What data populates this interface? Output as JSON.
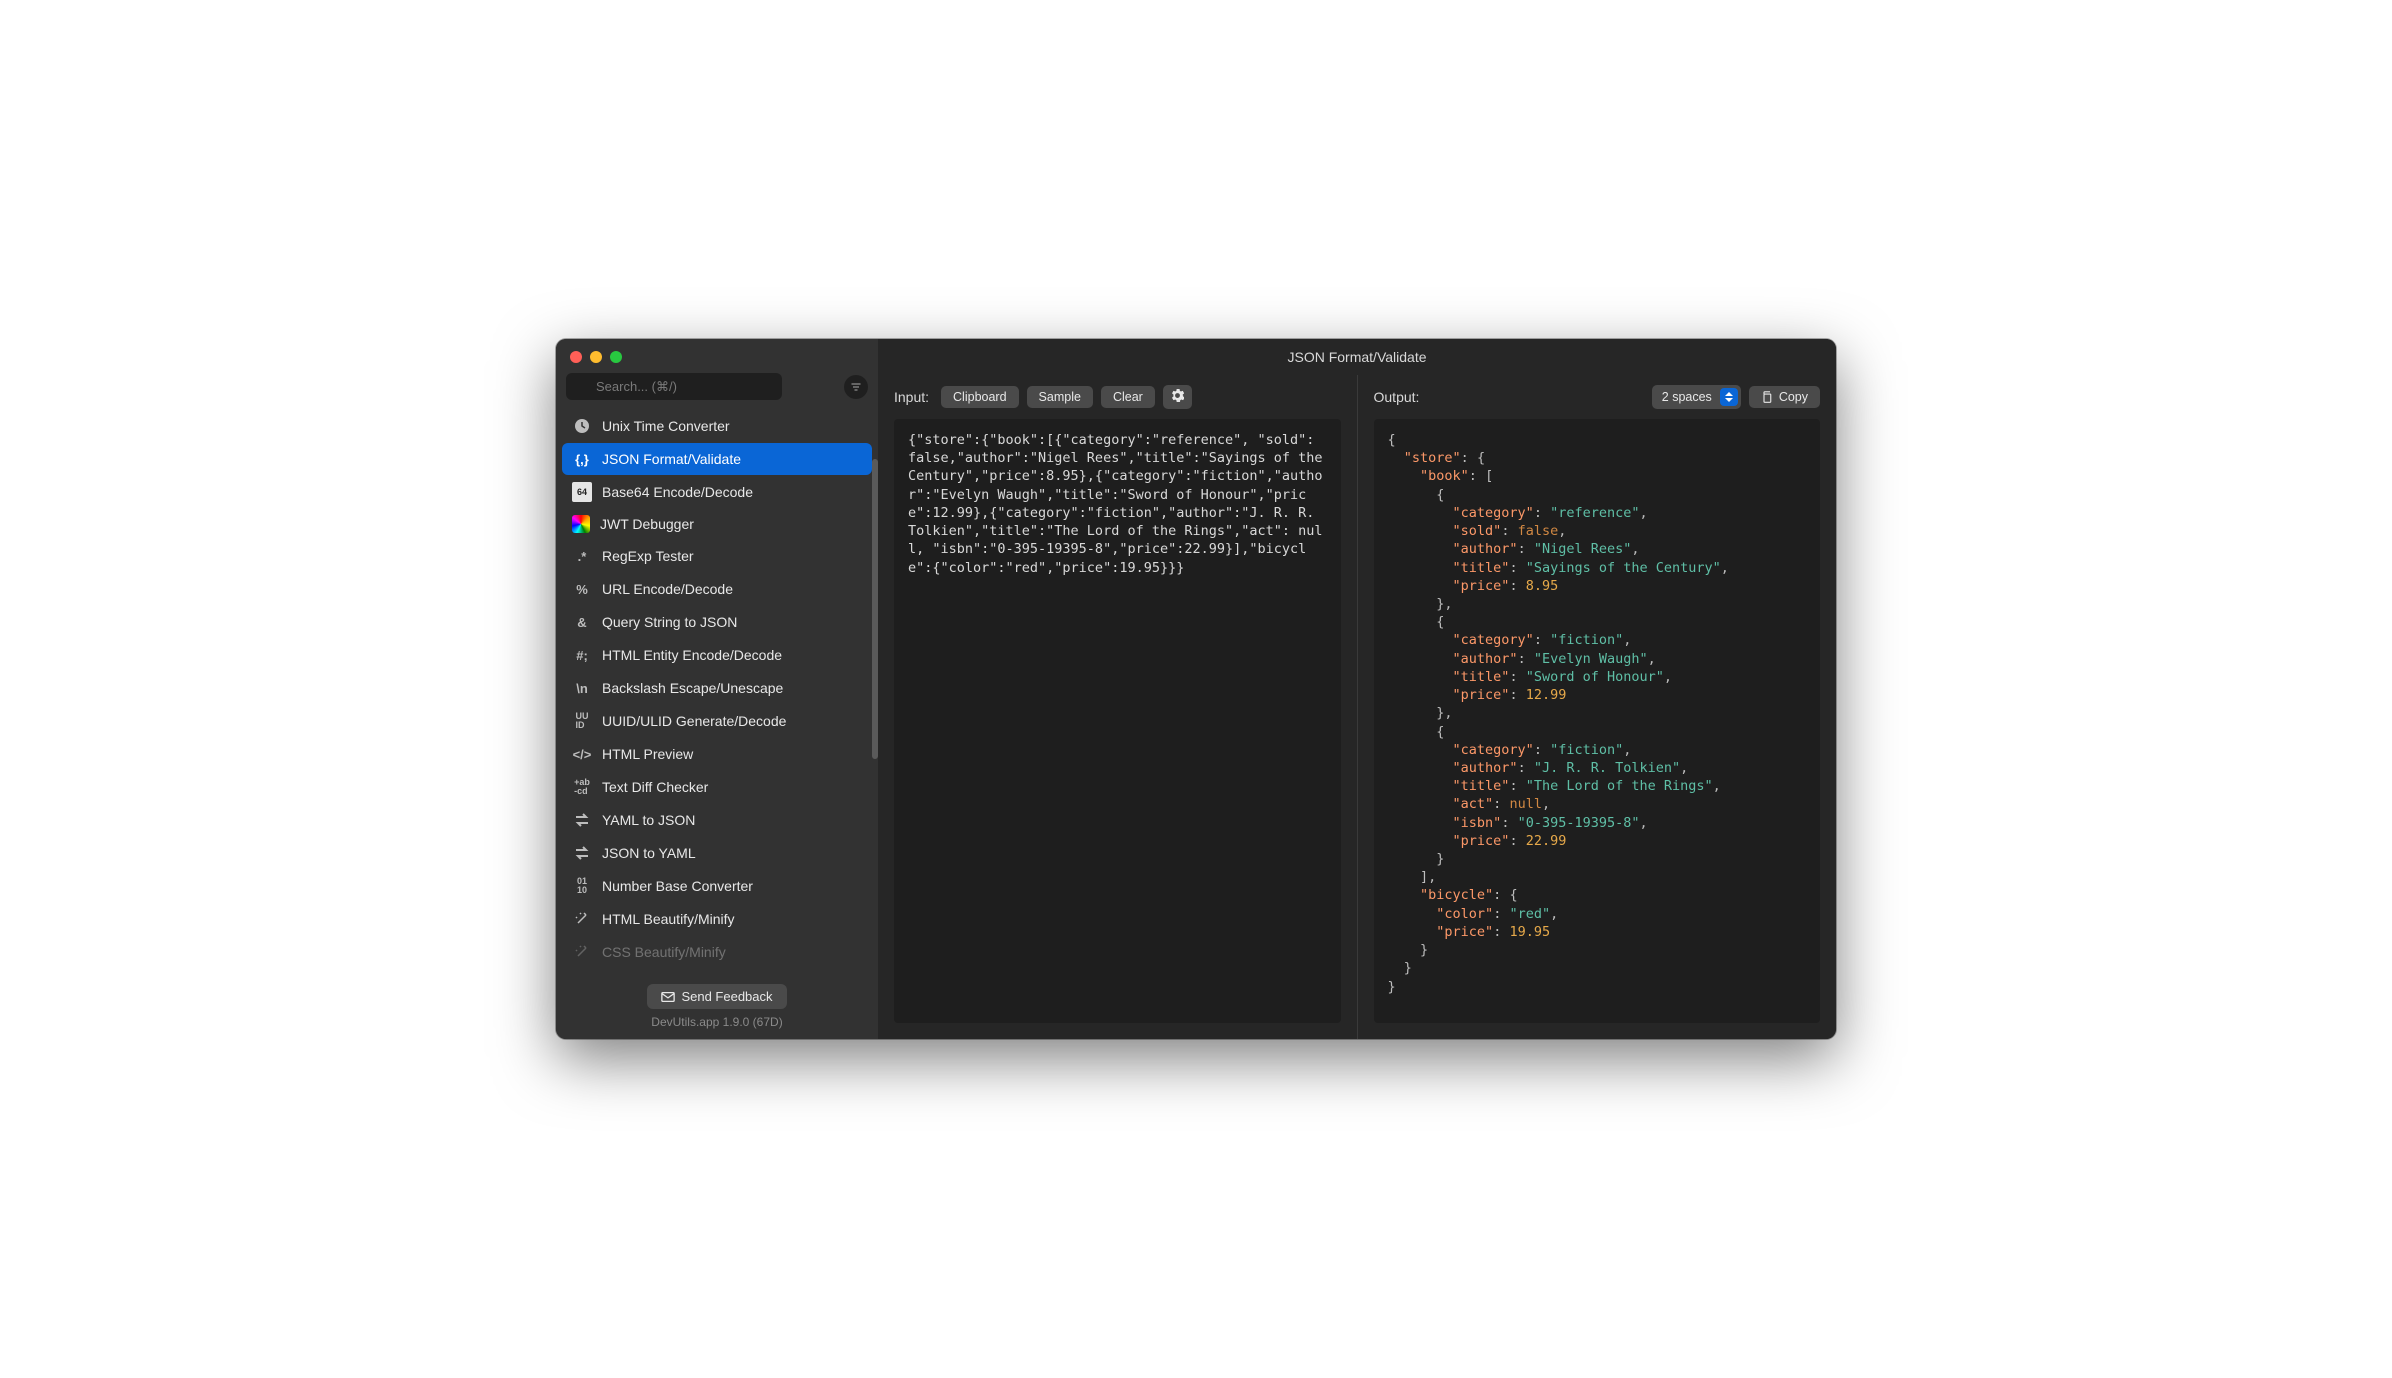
{
  "window": {
    "title": "JSON Format/Validate"
  },
  "search": {
    "placeholder": "Search... (⌘/)"
  },
  "sidebar": {
    "items": [
      {
        "label": "Unix Time Converter"
      },
      {
        "label": "JSON Format/Validate"
      },
      {
        "label": "Base64 Encode/Decode"
      },
      {
        "label": "JWT Debugger"
      },
      {
        "label": "RegExp Tester"
      },
      {
        "label": "URL Encode/Decode"
      },
      {
        "label": "Query String to JSON"
      },
      {
        "label": "HTML Entity Encode/Decode"
      },
      {
        "label": "Backslash Escape/Unescape"
      },
      {
        "label": "UUID/ULID Generate/Decode"
      },
      {
        "label": "HTML Preview"
      },
      {
        "label": "Text Diff Checker"
      },
      {
        "label": "YAML to JSON"
      },
      {
        "label": "JSON to YAML"
      },
      {
        "label": "Number Base Converter"
      },
      {
        "label": "HTML Beautify/Minify"
      },
      {
        "label": "CSS Beautify/Minify"
      }
    ]
  },
  "footer": {
    "feedback_label": "Send Feedback",
    "version_text": "DevUtils.app 1.9.0 (67D)"
  },
  "input": {
    "label": "Input:",
    "buttons": {
      "clipboard": "Clipboard",
      "sample": "Sample",
      "clear": "Clear"
    },
    "content": "{\"store\":{\"book\":[{\"category\":\"reference\", \"sold\": false,\"author\":\"Nigel Rees\",\"title\":\"Sayings of the Century\",\"price\":8.95},{\"category\":\"fiction\",\"author\":\"Evelyn Waugh\",\"title\":\"Sword of Honour\",\"price\":12.99},{\"category\":\"fiction\",\"author\":\"J. R. R. Tolkien\",\"title\":\"The Lord of the Rings\",\"act\": null, \"isbn\":\"0-395-19395-8\",\"price\":22.99}],\"bicycle\":{\"color\":\"red\",\"price\":19.95}}}"
  },
  "output": {
    "label": "Output:",
    "indent_label": "2 spaces",
    "copy_label": "Copy",
    "json": {
      "store": {
        "book": [
          {
            "category": "reference",
            "sold": false,
            "author": "Nigel Rees",
            "title": "Sayings of the Century",
            "price": 8.95
          },
          {
            "category": "fiction",
            "author": "Evelyn Waugh",
            "title": "Sword of Honour",
            "price": 12.99
          },
          {
            "category": "fiction",
            "author": "J. R. R. Tolkien",
            "title": "The Lord of the Rings",
            "act": null,
            "isbn": "0-395-19395-8",
            "price": 22.99
          }
        ],
        "bicycle": {
          "color": "red",
          "price": 19.95
        }
      }
    }
  }
}
